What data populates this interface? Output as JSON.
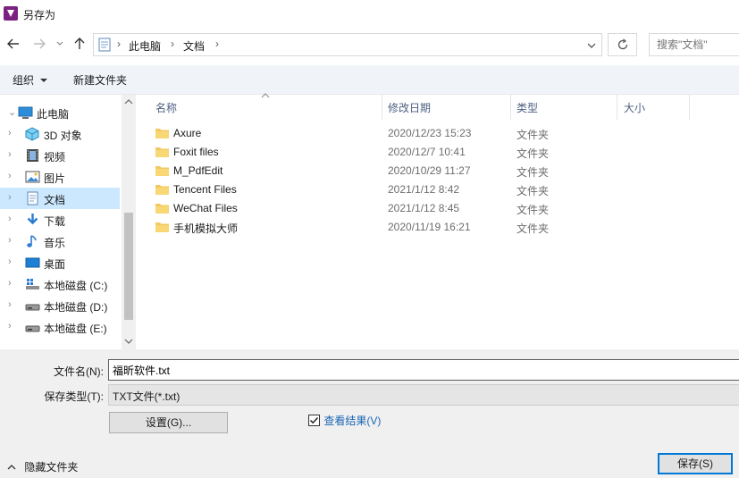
{
  "window": {
    "title": "另存为"
  },
  "address": {
    "segments": [
      "此电脑",
      "文档"
    ]
  },
  "search": {
    "placeholder": "搜索\"文档\""
  },
  "toolbar": {
    "organize_label": "组织",
    "new_folder_label": "新建文件夹"
  },
  "nav": {
    "items": [
      {
        "label": "此电脑",
        "icon": "pc-icon"
      },
      {
        "label": "3D 对象",
        "icon": "3d-objects-icon"
      },
      {
        "label": "视频",
        "icon": "video-icon"
      },
      {
        "label": "图片",
        "icon": "picture-icon"
      },
      {
        "label": "文档",
        "icon": "document-icon"
      },
      {
        "label": "下载",
        "icon": "download-icon"
      },
      {
        "label": "音乐",
        "icon": "music-icon"
      },
      {
        "label": "桌面",
        "icon": "desktop-icon"
      },
      {
        "label": "本地磁盘 (C:)",
        "icon": "drive-c-icon"
      },
      {
        "label": "本地磁盘 (D:)",
        "icon": "drive-icon"
      },
      {
        "label": "本地磁盘 (E:)",
        "icon": "drive-icon"
      }
    ]
  },
  "columns": {
    "name": "名称",
    "date": "修改日期",
    "type": "类型",
    "size": "大小"
  },
  "files": [
    {
      "name": "Axure",
      "date": "2020/12/23 15:23",
      "type": "文件夹"
    },
    {
      "name": "Foxit files",
      "date": "2020/12/7 10:41",
      "type": "文件夹"
    },
    {
      "name": "M_PdfEdit",
      "date": "2020/10/29 11:27",
      "type": "文件夹"
    },
    {
      "name": "Tencent Files",
      "date": "2021/1/12 8:42",
      "type": "文件夹"
    },
    {
      "name": "WeChat Files",
      "date": "2021/1/12 8:45",
      "type": "文件夹"
    },
    {
      "name": "手机模拟大师",
      "date": "2020/11/19 16:21",
      "type": "文件夹"
    }
  ],
  "form": {
    "filename_label": "文件名(N):",
    "filename_value": "福昕软件.txt",
    "filetype_label": "保存类型(T):",
    "filetype_value": "TXT文件(*.txt)",
    "settings_label": "设置(G)...",
    "view_results_label": "查看结果(V)",
    "view_results_checked": true,
    "hide_folders_label": "隐藏文件夹",
    "save_label": "保存(S)"
  },
  "colors": {
    "accent": "#0078d7",
    "folder": "#f3c863",
    "selection": "#cce8ff",
    "link": "#1a65b4"
  }
}
